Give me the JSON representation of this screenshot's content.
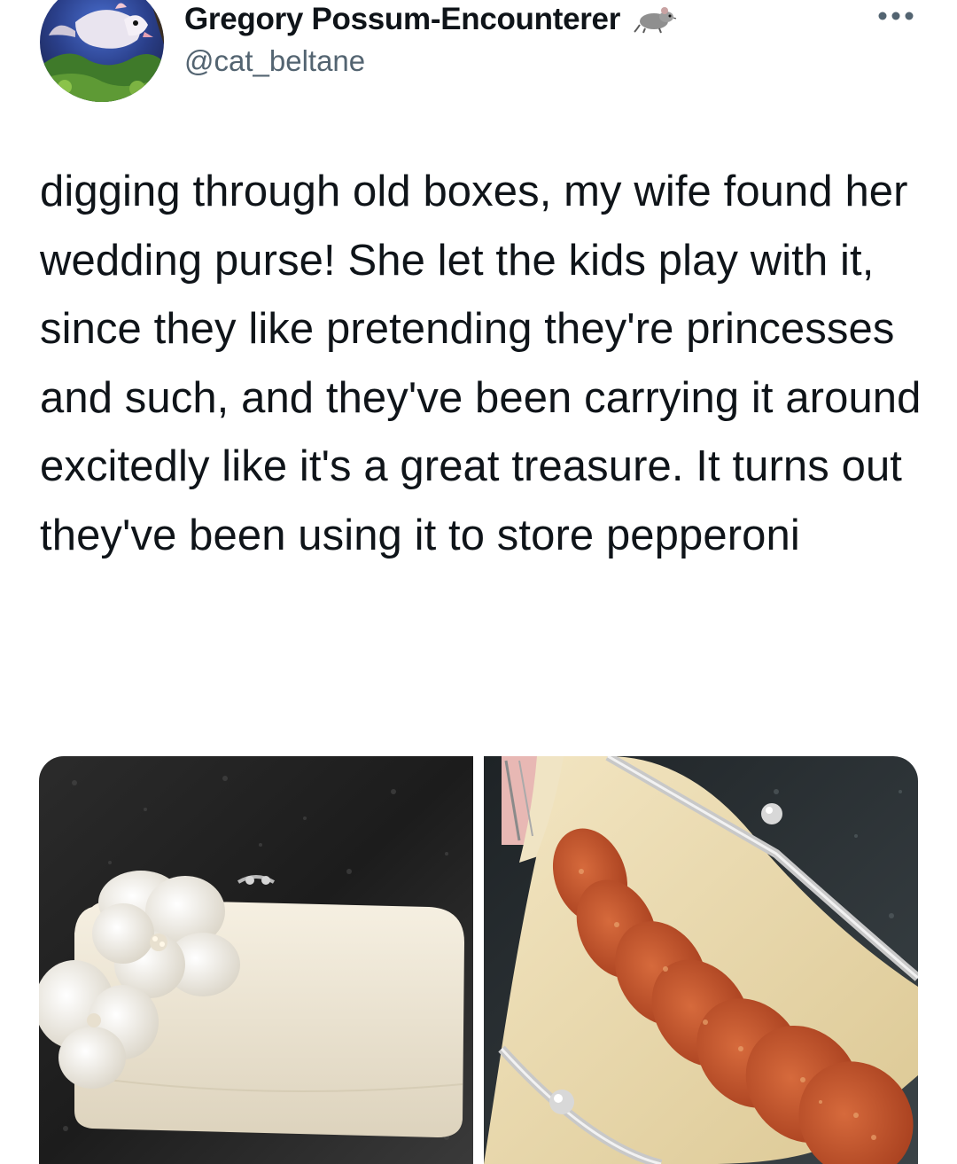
{
  "tweet": {
    "author": {
      "display_name": "Gregory Possum-Encounterer",
      "handle": "@cat_beltane",
      "avatar_icon": "possum-avatar",
      "name_emoji_icon": "rat-icon"
    },
    "more_icon": "more-options-icon",
    "text": "digging through old boxes, my wife found her wedding purse! She let the kids play with it, since they like pretending they're princesses and such, and they've been carrying it around excitedly like it's a great treasure. It turns out they've been using it to store pepperoni",
    "media": [
      {
        "icon": "photo-closed-white-purse"
      },
      {
        "icon": "photo-open-purse-pepperoni"
      }
    ]
  },
  "colors": {
    "text_primary": "#0f1419",
    "text_secondary": "#536471",
    "background": "#ffffff"
  }
}
